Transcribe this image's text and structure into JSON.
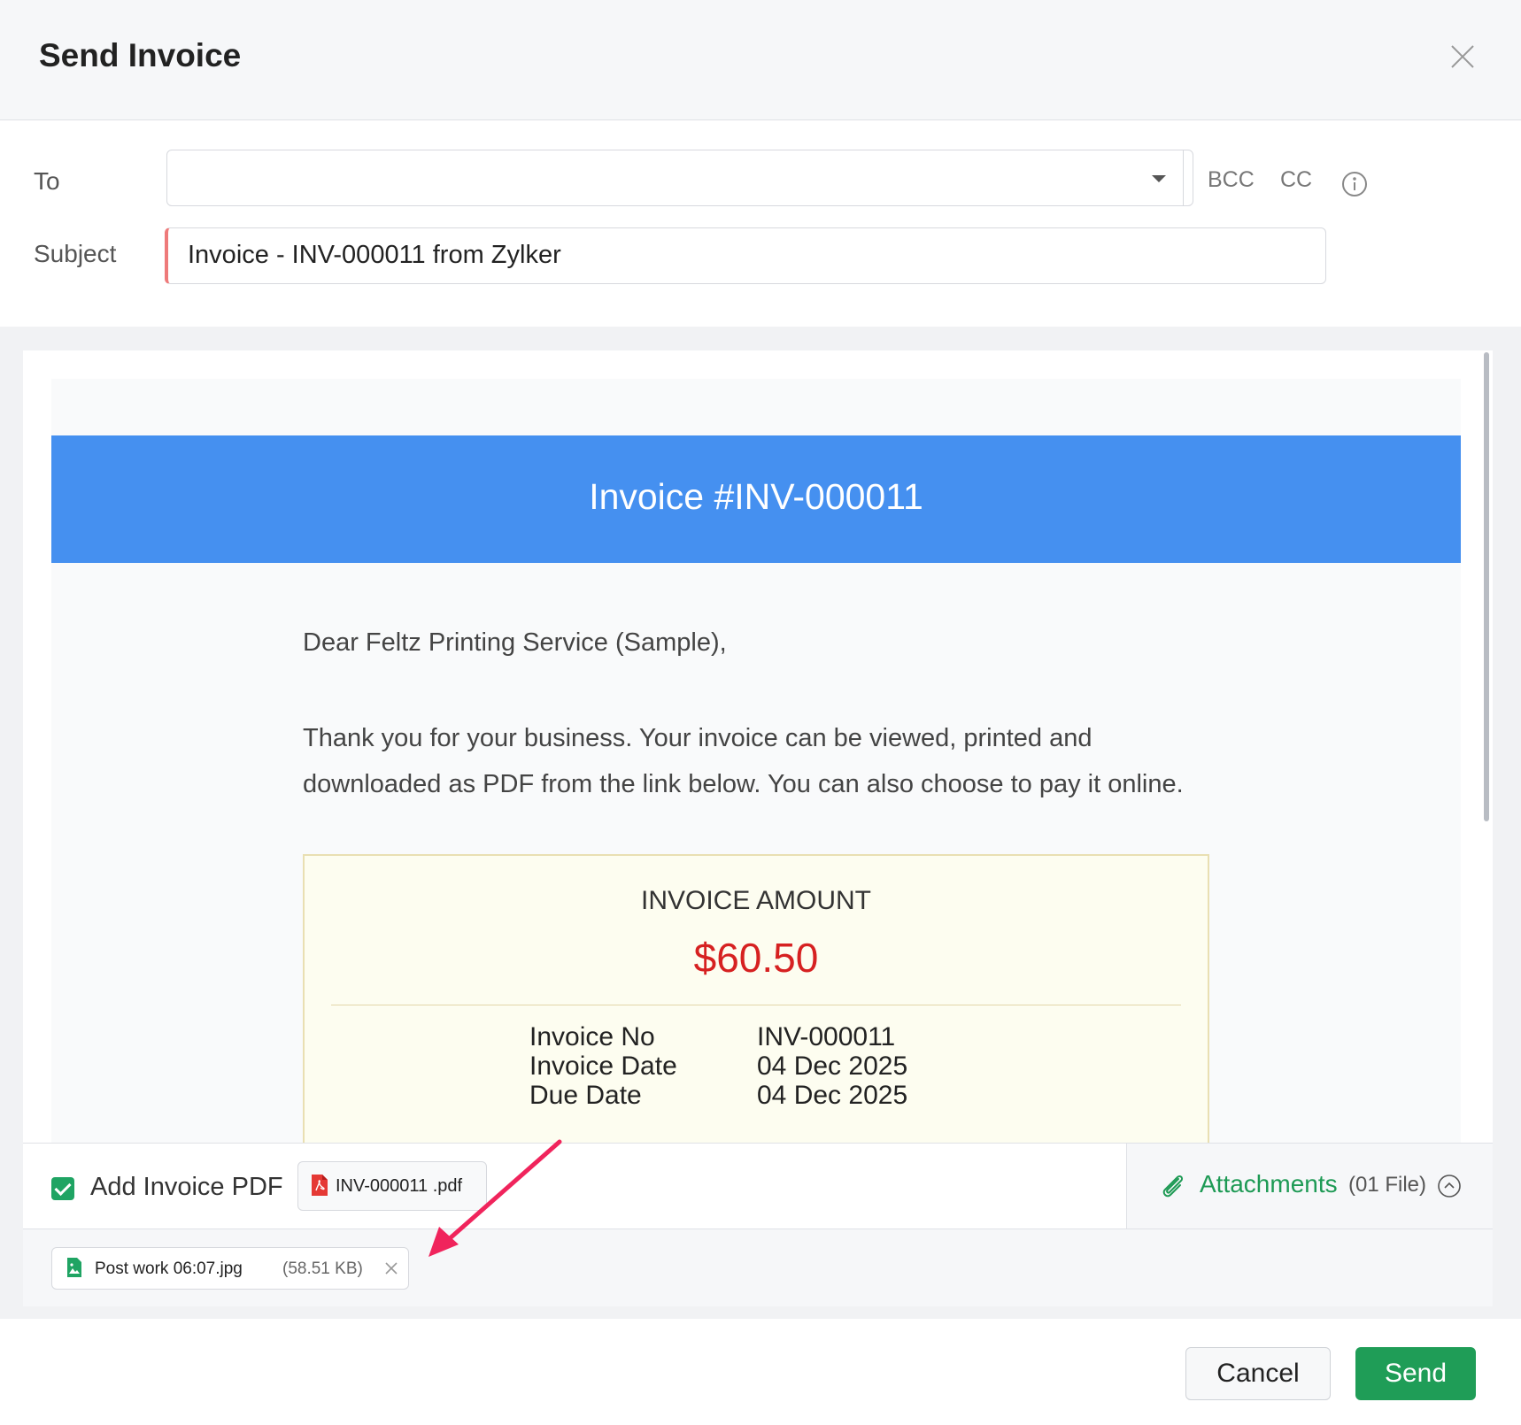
{
  "dialog": {
    "title": "Send Invoice",
    "close_icon": "close-icon"
  },
  "form": {
    "to_label": "To",
    "to_value": "",
    "bcc_label": "BCC",
    "cc_label": "CC",
    "info_icon": "info-icon",
    "subject_label": "Subject",
    "subject_value": "Invoice - INV-000011 from Zylker"
  },
  "email": {
    "banner_title": "Invoice #INV-000011",
    "banner_color": "#4590f0",
    "greeting": "Dear Feltz Printing Service (Sample),",
    "body_line1": "Thank you for your business. Your invoice can be viewed, printed and",
    "body_line2": "downloaded as PDF from the link below. You can also choose to pay it online.",
    "amount_label": "INVOICE AMOUNT",
    "amount_value": "$60.50",
    "amount_color": "#d62121",
    "details": [
      {
        "label": "Invoice No",
        "value": "INV-000011"
      },
      {
        "label": "Invoice Date",
        "value": "04 Dec 2025"
      },
      {
        "label": "Due Date",
        "value": "04 Dec 2025"
      }
    ]
  },
  "attachments": {
    "add_pdf_checked": true,
    "add_pdf_label": "Add Invoice PDF",
    "pdf_file_name": "INV-000011 .pdf",
    "attachments_label": "Attachments",
    "attachments_count": "(01 File)",
    "files": [
      {
        "name": "Post work 06:07.jpg",
        "size": "(58.51 KB)"
      }
    ],
    "accent_color": "#1e9a55"
  },
  "footer": {
    "cancel_label": "Cancel",
    "send_label": "Send",
    "send_color": "#1f9d57"
  }
}
